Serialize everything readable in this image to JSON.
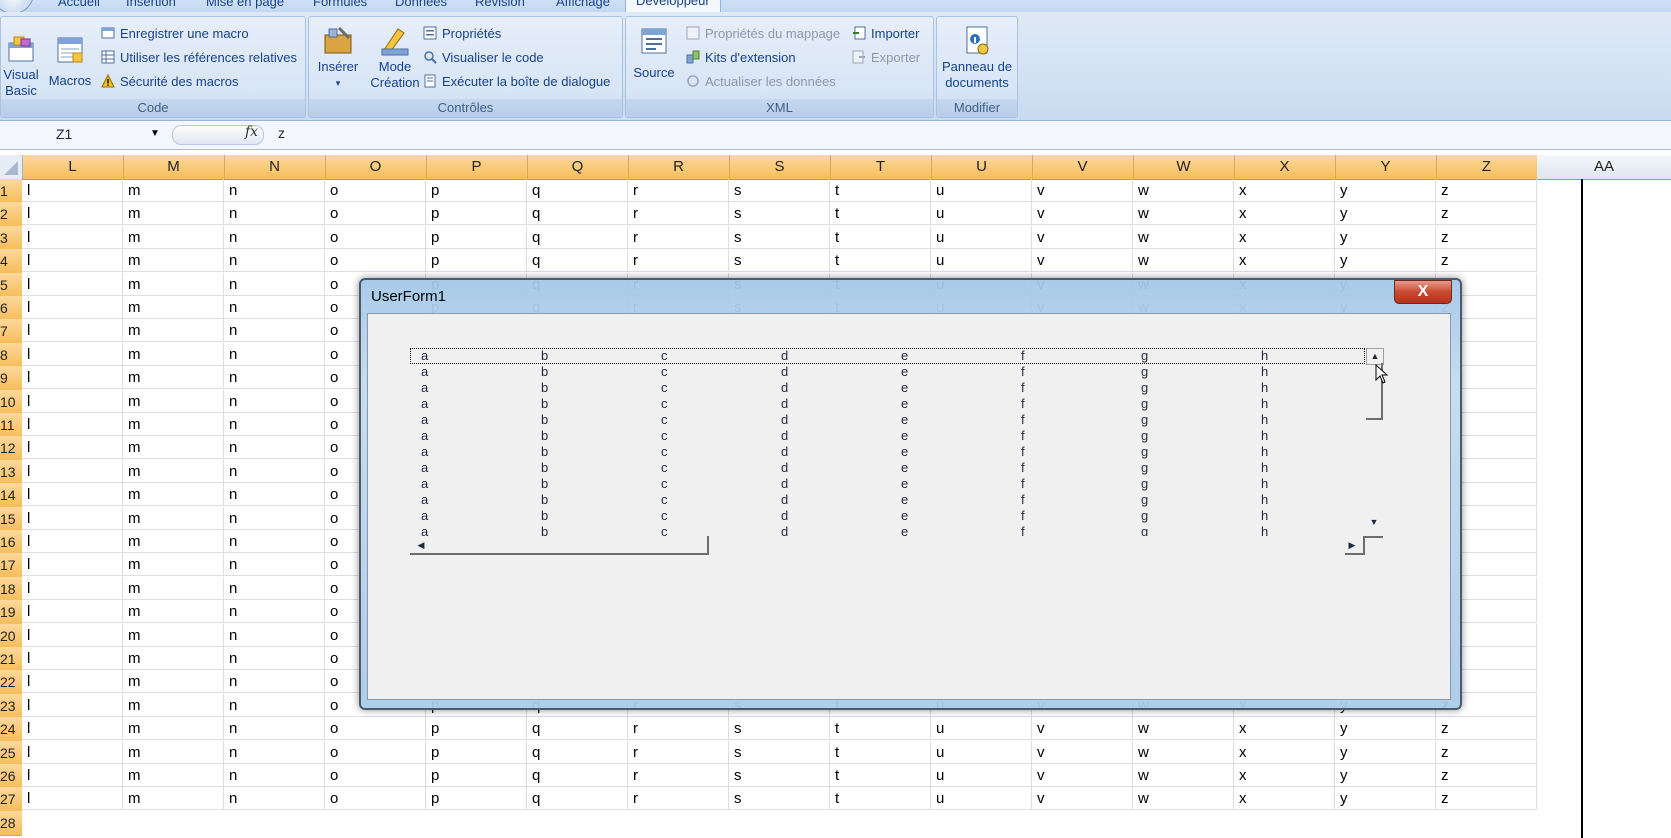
{
  "ribbon": {
    "tabs": [
      "Accueil",
      "Insertion",
      "Mise en page",
      "Formules",
      "Données",
      "Révision",
      "Affichage",
      "Développeur"
    ],
    "active_tab": "Développeur",
    "groups": {
      "code": {
        "label": "Code",
        "visual_basic": "Visual\nBasic",
        "macros": "Macros",
        "record_macro": "Enregistrer une macro",
        "relative_refs": "Utiliser les références relatives",
        "macro_security": "Sécurité des macros"
      },
      "controls": {
        "label": "Contrôles",
        "insert": "Insérer",
        "design_mode": "Mode\nCréation",
        "properties": "Propriétés",
        "view_code": "Visualiser le code",
        "run_dialog": "Exécuter la boîte de dialogue"
      },
      "xml": {
        "label": "XML",
        "source": "Source",
        "map_properties": "Propriétés du mappage",
        "expansion_packs": "Kits d'extension",
        "refresh_data": "Actualiser les données",
        "import": "Importer",
        "export": "Exporter"
      },
      "modify": {
        "label": "Modifier",
        "document_panel": "Panneau de\ndocuments"
      }
    }
  },
  "formula_bar": {
    "name_box": "Z1",
    "fx": "fx",
    "content": "z"
  },
  "sheet": {
    "columns": [
      "L",
      "M",
      "N",
      "O",
      "P",
      "Q",
      "R",
      "S",
      "T",
      "U",
      "V",
      "W",
      "X",
      "Y",
      "Z",
      "AA"
    ],
    "row_numbers": [
      "1",
      "2",
      "3",
      "4",
      "5",
      "6",
      "7",
      "8",
      "9",
      "10",
      "11",
      "12",
      "13",
      "14",
      "15",
      "16",
      "17",
      "18",
      "19",
      "20",
      "21",
      "22",
      "23",
      "24",
      "25",
      "26",
      "27",
      "28"
    ],
    "row_values": [
      "l",
      "m",
      "n",
      "o",
      "p",
      "q",
      "r",
      "s",
      "t",
      "u",
      "v",
      "w",
      "x",
      "y",
      "z"
    ]
  },
  "userform": {
    "title": "UserForm1",
    "close": "X",
    "listbox": {
      "columns": [
        "a",
        "b",
        "c",
        "d",
        "e",
        "f",
        "g",
        "h"
      ],
      "row_count": 12
    }
  }
}
